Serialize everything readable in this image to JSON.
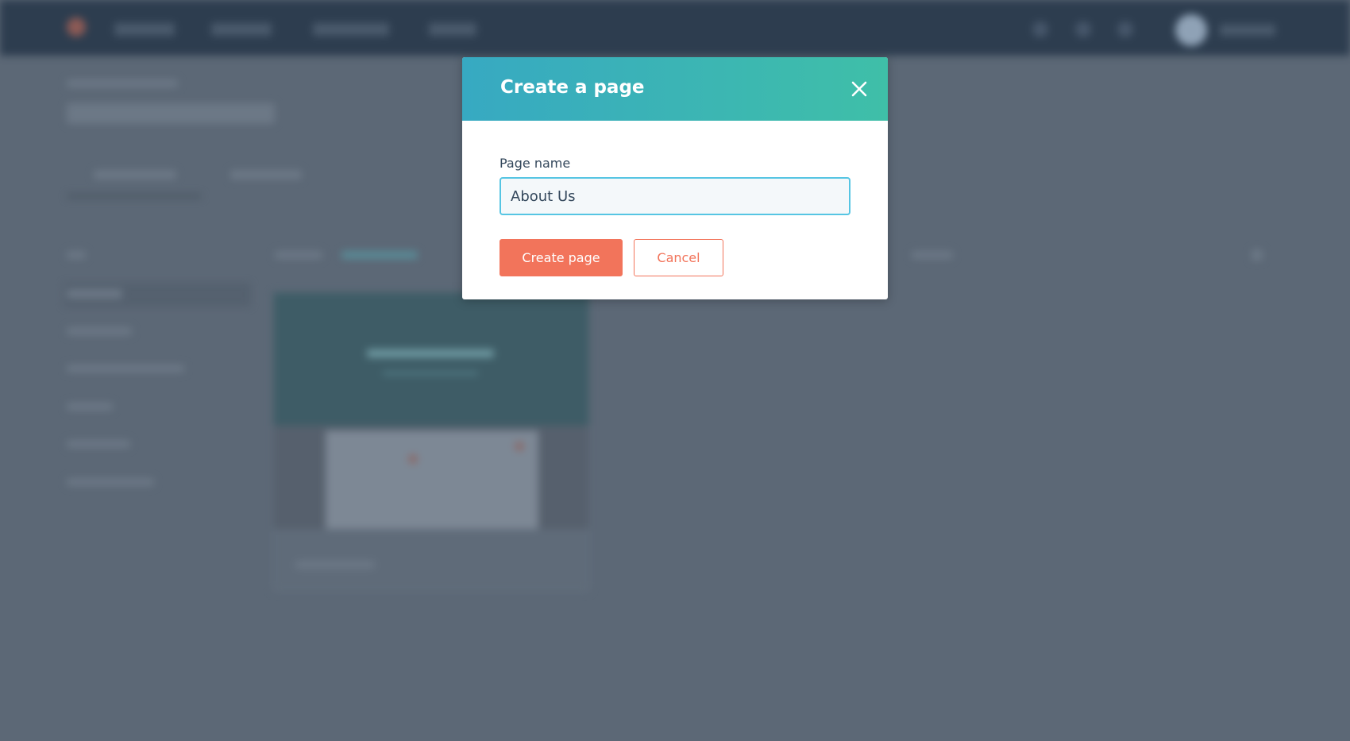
{
  "modal": {
    "title": "Create a page",
    "close_icon": "close-icon",
    "field_label": "Page name",
    "page_name_value": "About Us",
    "primary_button": "Create page",
    "secondary_button": "Cancel"
  },
  "colors": {
    "header_gradient_start": "#37a9c2",
    "header_gradient_end": "#3fbfa8",
    "accent": "#f2745b",
    "input_focus": "#56c5e3",
    "backdrop": "#5c6876"
  }
}
